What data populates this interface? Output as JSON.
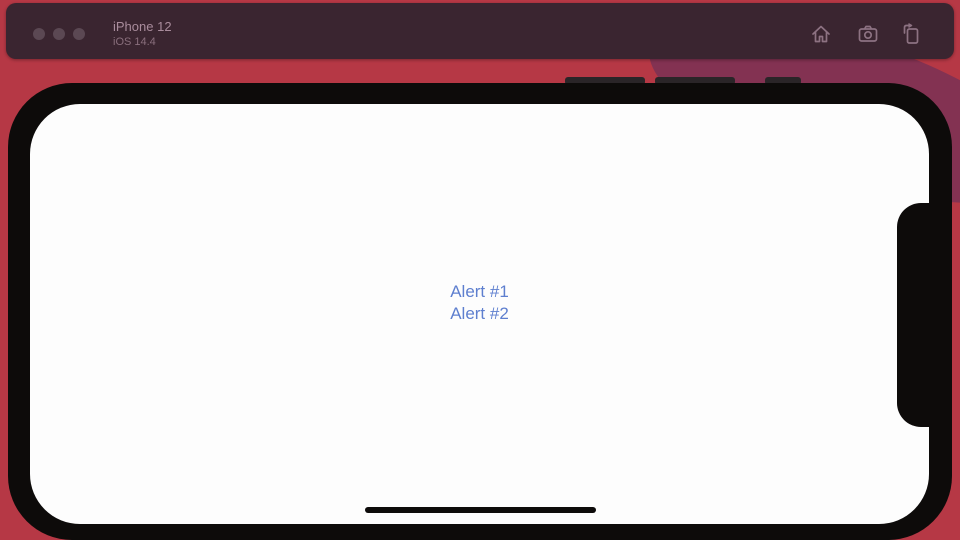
{
  "simulator": {
    "device_name": "iPhone 12",
    "os_version": "iOS 14.4",
    "toolbar_icons": [
      "home-icon",
      "screenshot-icon",
      "rotate-icon"
    ]
  },
  "app": {
    "buttons": [
      {
        "label": "Alert #1"
      },
      {
        "label": "Alert #2"
      }
    ]
  },
  "colors": {
    "background": "#b63845",
    "toolbar": "#3a2530",
    "device_bezel": "#0d0b0a",
    "screen": "#fdfdfd",
    "accent": "#5e7fcf"
  }
}
